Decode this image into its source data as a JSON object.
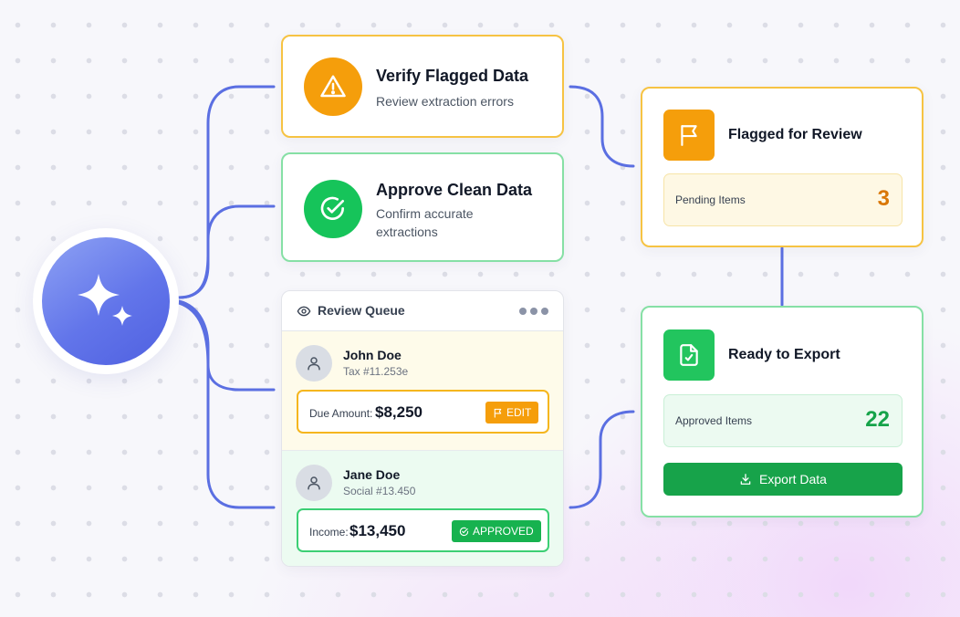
{
  "verify_task": {
    "title": "Verify Flagged Data",
    "subtitle": "Review extraction errors",
    "icon": "warning-icon",
    "color": "#f59e0b"
  },
  "approve_task": {
    "title": "Approve Clean Data",
    "subtitle": "Confirm accurate extractions",
    "icon": "check-circle-icon",
    "color": "#16a34a"
  },
  "review_queue": {
    "title": "Review Queue",
    "icons": [
      "eye-icon",
      "more-icon"
    ],
    "items": [
      {
        "name": "John Doe",
        "reference": "Tax #11.253e",
        "amount_label": "Due Amount:",
        "amount": "$8,250",
        "action": "EDIT",
        "action_icon": "flag-icon",
        "status_color": "#f59e0b"
      },
      {
        "name": "Jane Doe",
        "reference": "Social #13.450",
        "amount_label": "Income:",
        "amount": "$13,450",
        "action": "APPROVED",
        "action_icon": "check-circle-icon",
        "status_color": "#16a34a"
      }
    ]
  },
  "flagged_panel": {
    "title": "Flagged for Review",
    "icon": "flag-icon",
    "stat_label": "Pending Items",
    "stat_value": "3",
    "color": "#f59e0b"
  },
  "export_panel": {
    "title": "Ready to Export",
    "icon": "file-check-icon",
    "stat_label": "Approved Items",
    "stat_value": "22",
    "button_label": "Export Data",
    "button_icon": "download-icon",
    "color": "#16a34a"
  },
  "hub": {
    "icon": "sparkle-icon",
    "color": "#6275ea"
  }
}
